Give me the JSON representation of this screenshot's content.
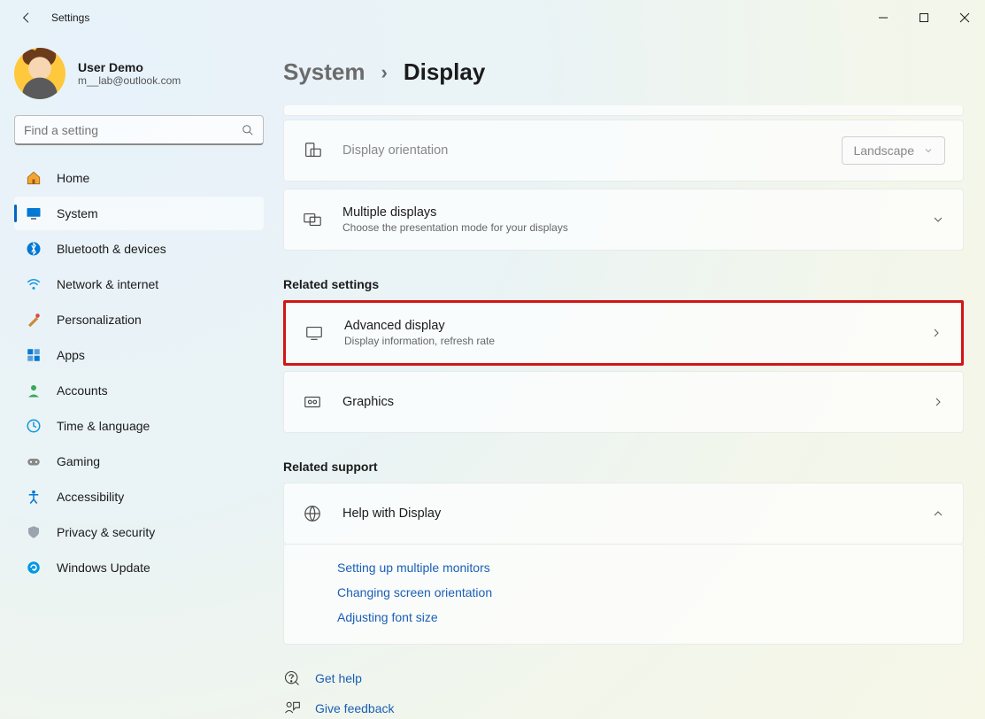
{
  "window": {
    "title": "Settings"
  },
  "user": {
    "name": "User Demo",
    "email": "m__lab@outlook.com"
  },
  "search": {
    "placeholder": "Find a setting"
  },
  "nav": [
    {
      "label": "Home"
    },
    {
      "label": "System"
    },
    {
      "label": "Bluetooth & devices"
    },
    {
      "label": "Network & internet"
    },
    {
      "label": "Personalization"
    },
    {
      "label": "Apps"
    },
    {
      "label": "Accounts"
    },
    {
      "label": "Time & language"
    },
    {
      "label": "Gaming"
    },
    {
      "label": "Accessibility"
    },
    {
      "label": "Privacy & security"
    },
    {
      "label": "Windows Update"
    }
  ],
  "breadcrumb": {
    "parent": "System",
    "current": "Display"
  },
  "rows": {
    "orientation": {
      "title": "Display orientation",
      "value": "Landscape"
    },
    "multipleDisplays": {
      "title": "Multiple displays",
      "sub": "Choose the presentation mode for your displays"
    },
    "advancedDisplay": {
      "title": "Advanced display",
      "sub": "Display information, refresh rate"
    },
    "graphics": {
      "title": "Graphics"
    },
    "helpDisplay": {
      "title": "Help with Display"
    }
  },
  "sections": {
    "relatedSettings": "Related settings",
    "relatedSupport": "Related support"
  },
  "helpLinks": [
    "Setting up multiple monitors",
    "Changing screen orientation",
    "Adjusting font size"
  ],
  "bottom": {
    "getHelp": "Get help",
    "giveFeedback": "Give feedback"
  }
}
